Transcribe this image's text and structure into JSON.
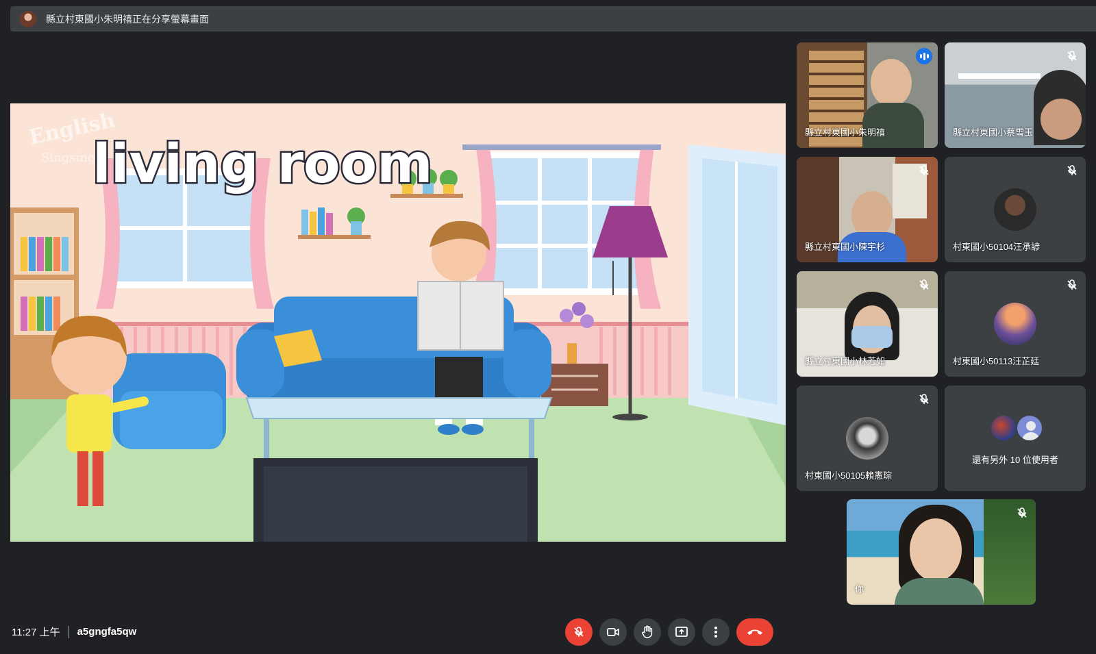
{
  "banner": {
    "text": "縣立村東國小朱明禧正在分享螢幕畫面"
  },
  "presentation": {
    "title": "living room",
    "watermark_line1": "English",
    "watermark_line2": "Singsing"
  },
  "participants": [
    {
      "name": "縣立村東國小朱明禧",
      "speaking": true,
      "muted": false,
      "video": true
    },
    {
      "name": "縣立村東國小蔡雪玉",
      "muted": true,
      "video": true
    },
    {
      "name": "縣立村東國小陳宇杉",
      "muted": true,
      "video": true
    },
    {
      "name": "村東國小50104汪承諺",
      "muted": true,
      "video": false
    },
    {
      "name": "縣立村東國小林芳如",
      "muted": true,
      "video": true
    },
    {
      "name": "村東國小50113汪芷廷",
      "muted": true,
      "video": false
    },
    {
      "name": "村東國小50105賴憲琮",
      "muted": true,
      "video": false
    }
  ],
  "others": {
    "label": "還有另外 10 位使用者"
  },
  "self": {
    "label": "你",
    "muted": true
  },
  "footer": {
    "time": "11:27 上午",
    "meeting_code": "a5gngfa5qw"
  },
  "controls": [
    "microphone-off",
    "camera",
    "raise-hand",
    "present-screen",
    "more-options",
    "leave-call"
  ],
  "colors": {
    "background": "#202124",
    "tile": "#3c4043",
    "active_outline": "#8ab4f8",
    "danger": "#ea4335"
  }
}
